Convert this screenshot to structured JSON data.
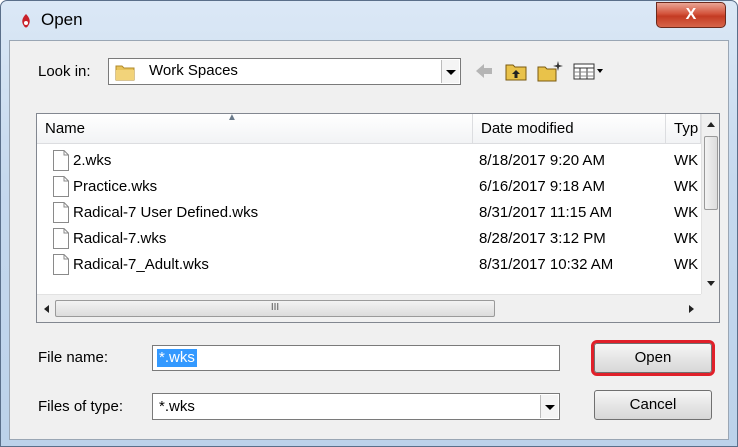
{
  "window": {
    "title": "Open",
    "close_label": "X"
  },
  "lookin": {
    "label": "Look in:",
    "value": "Work Spaces"
  },
  "columns": [
    {
      "label": "Name"
    },
    {
      "label": "Date modified"
    },
    {
      "label": "Typ"
    }
  ],
  "files": [
    {
      "name": "2.wks",
      "date": "8/18/2017 9:20 AM",
      "type": "WK"
    },
    {
      "name": "Practice.wks",
      "date": "6/16/2017 9:18 AM",
      "type": "WK"
    },
    {
      "name": "Radical-7 User Defined.wks",
      "date": "8/31/2017 11:15 AM",
      "type": "WK"
    },
    {
      "name": "Radical-7.wks",
      "date": "8/28/2017 3:12 PM",
      "type": "WK"
    },
    {
      "name": "Radical-7_Adult.wks",
      "date": "8/31/2017 10:32 AM",
      "type": "WK"
    }
  ],
  "scrollbar": {
    "thumb_grip": "III"
  },
  "filename": {
    "label": "File name:",
    "value": "*.wks"
  },
  "filetype": {
    "label": "Files of type:",
    "value": "*.wks"
  },
  "buttons": {
    "open": "Open",
    "cancel": "Cancel"
  },
  "icons": {
    "title": "app-icon",
    "folder": "folder-icon",
    "back": "back-arrow-icon",
    "up": "up-folder-icon",
    "new_folder": "new-folder-icon",
    "views": "views-menu-icon",
    "file": "document-icon"
  },
  "colors": {
    "highlight": "#e0202a",
    "selection": "#3399ff",
    "close_button": "#c43b23"
  }
}
